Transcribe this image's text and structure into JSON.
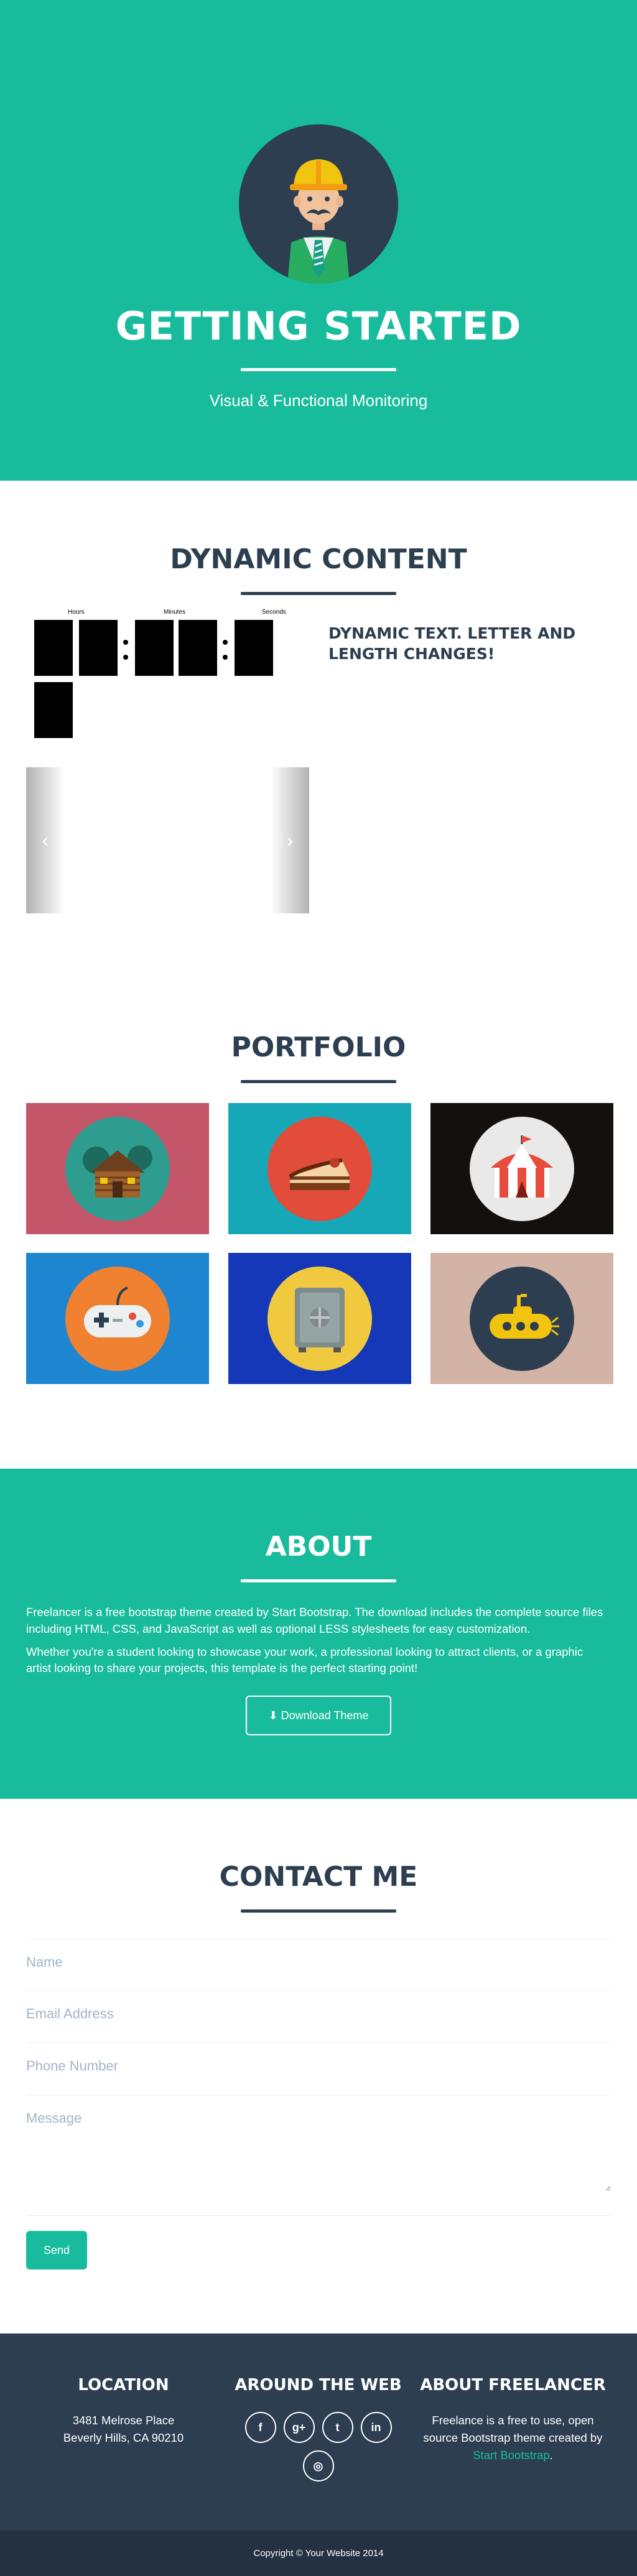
{
  "hero": {
    "title": "GETTING STARTED",
    "subtitle": "Visual & Functional Monitoring"
  },
  "dynamic": {
    "title": "DYNAMIC CONTENT",
    "countdown_labels": {
      "hours": "Hours",
      "minutes": "Minutes",
      "seconds": "Seconds"
    },
    "text": "DYNAMIC TEXT. LETTER AND LENGTH CHANGES!",
    "carousel_prev": "‹",
    "carousel_next": "›"
  },
  "portfolio": {
    "title": "PORTFOLIO",
    "items": [
      {
        "name": "cabin",
        "bg": "#c4566a",
        "circle": "#2e9d8f"
      },
      {
        "name": "cake",
        "bg": "#17a8b8",
        "circle": "#e24c3b"
      },
      {
        "name": "circus",
        "bg": "#14100d",
        "circle": "#e9e9e9"
      },
      {
        "name": "game",
        "bg": "#1e86d0",
        "circle": "#ef8131"
      },
      {
        "name": "safe",
        "bg": "#1438b8",
        "circle": "#f1c93f"
      },
      {
        "name": "submarine",
        "bg": "#d2b3a5",
        "circle": "#2c3e50"
      }
    ]
  },
  "about": {
    "title": "ABOUT",
    "p1": "Freelancer is a free bootstrap theme created by Start Bootstrap. The download includes the complete source files including HTML, CSS, and JavaScript as well as optional LESS stylesheets for easy customization.",
    "p2": "Whether you're a student looking to showcase your work, a professional looking to attract clients, or a graphic artist looking to share your projects, this template is the perfect starting point!",
    "button": "⬇ Download Theme"
  },
  "contact": {
    "title": "CONTACT ME",
    "name_placeholder": "Name",
    "email_placeholder": "Email Address",
    "phone_placeholder": "Phone Number",
    "message_placeholder": "Message",
    "send": "Send"
  },
  "footer": {
    "location_title": "LOCATION",
    "address1": "3481 Melrose Place",
    "address2": "Beverly Hills, CA 90210",
    "web_title": "AROUND THE WEB",
    "socials": [
      "f",
      "g+",
      "t",
      "in",
      "◎"
    ],
    "about_title": "ABOUT FREELANCER",
    "about_text": "Freelance is a free to use, open source Bootstrap theme created by",
    "about_link": "Start Bootstrap",
    "about_end": ".",
    "copyright": "Copyright © Your Website 2014"
  },
  "colors": {
    "primary": "#18bc9c",
    "dark": "#2c3e50"
  }
}
